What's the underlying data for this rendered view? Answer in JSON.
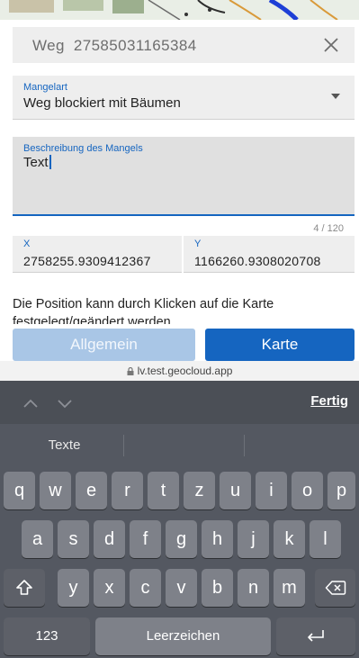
{
  "form": {
    "title_type": "Weg",
    "title_id": "27585031165384",
    "defect_type_label": "Mangelart",
    "defect_type_value": "Weg blockiert mit Bäumen",
    "description_label": "Beschreibung des Mangels",
    "description_value": "Text",
    "char_count": "4 / 120",
    "x_label": "X",
    "x_value": "2758255.9309412367",
    "y_label": "Y",
    "y_value": "1166260.9308020708",
    "hint": "Die Position kann durch Klicken auf die Karte festgelegt/geändert werden",
    "general_button": "Allgemein",
    "map_button": "Karte"
  },
  "browser": {
    "url": "lv.test.geocloud.app"
  },
  "keyboard": {
    "done_label": "Fertig",
    "suggestions": [
      "Texte",
      "",
      ""
    ],
    "row1": [
      "q",
      "w",
      "e",
      "r",
      "t",
      "z",
      "u",
      "i",
      "o",
      "p"
    ],
    "row2": [
      "a",
      "s",
      "d",
      "f",
      "g",
      "h",
      "j",
      "k",
      "l"
    ],
    "row3": [
      "y",
      "x",
      "c",
      "v",
      "b",
      "n",
      "m"
    ],
    "numbers_label": "123",
    "space_label": "Leerzeichen"
  },
  "colors": {
    "accent": "#1565c0",
    "accent_light": "#a9c6e6",
    "keyboard_bg": "#545861"
  }
}
